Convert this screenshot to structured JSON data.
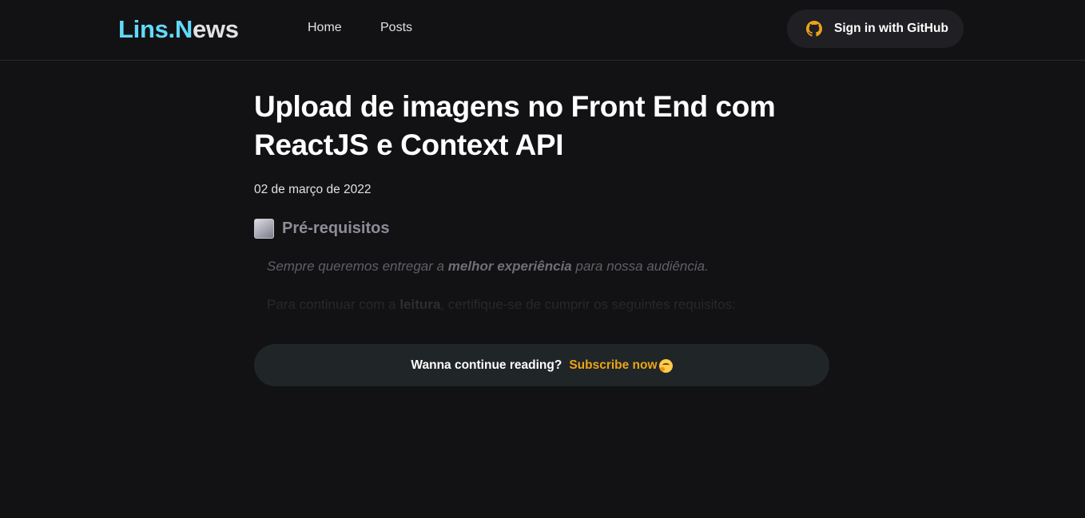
{
  "header": {
    "logo_part1": "Lins.",
    "logo_part2_accent": "N",
    "logo_part3": "ews",
    "nav": [
      {
        "label": "Home"
      },
      {
        "label": "Posts"
      }
    ],
    "signin_label": "Sign in with GitHub",
    "signin_icon": "github-icon"
  },
  "post": {
    "title": "Upload de imagens no Front End com ReactJS e Context API",
    "date": "02 de março de 2022",
    "section_icon": "white-square-button-icon",
    "section_heading": "Pré-requisitos",
    "p1_a": "Sempre queremos entregar a ",
    "p1_b": "melhor experiência",
    "p1_c": " para nossa audiência.",
    "p2_a": "Para continuar com a ",
    "p2_b": "leitura",
    "p2_c": ", certifique-se de cumprir os seguintes requisitos:"
  },
  "paywall": {
    "question": "Wanna continue reading?",
    "subscribe_label": "Subscribe now",
    "emoji": "hugging-face-emoji"
  },
  "colors": {
    "background": "#121214",
    "accent_blue": "#61dafb",
    "subscribe_yellow": "#eba417",
    "button_bg": "#202024",
    "github_icon": "#eba417"
  }
}
